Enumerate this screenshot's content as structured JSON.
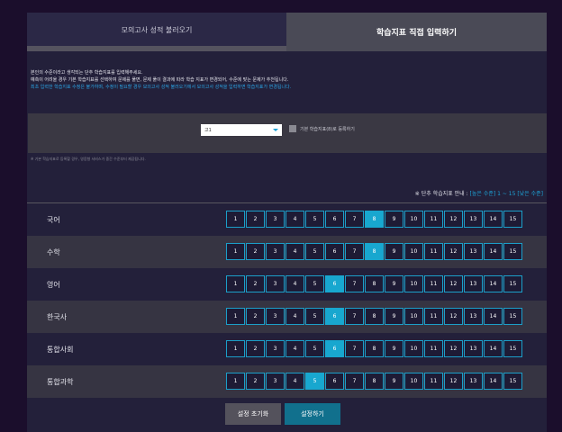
{
  "tabs": {
    "load": "모의고사 성적 불러오기",
    "direct": "학습지표 직접 입력하기"
  },
  "intro": {
    "line1": "본인의 수준이라고 생각되는 단추 학습지표를 입력해주세요.",
    "line2": "예측이 어려울 경우 기본 학습지표를 선택하여 문제를 풀면, 문제 풀이 결과에 따라 학습 지표가 변경되어, 수준에 맞는 문제가 추천됩니다.",
    "line3": "최초 입력한 학습지표 수정은 불가하며, 수정이 필요할 경우 모의고사 성적 불러오기에서 모의고사 성적을 입력하면 학습지표가 변경됩니다."
  },
  "controls": {
    "grade_value": "고1",
    "checkbox_label": "기본 학습지표(8)로 등록하기"
  },
  "footnote": "※ 기본 학습지표로 등록할 경우, 영웅형 서비스가 중간 수준부터 제공됩니다.",
  "legend": {
    "prefix": "※ 단추 학습지표 안내 : ",
    "highlight": "[높은 수준] 1 ~ 15 [낮은 수준]"
  },
  "levels": [
    "1",
    "2",
    "3",
    "4",
    "5",
    "6",
    "7",
    "8",
    "9",
    "10",
    "11",
    "12",
    "13",
    "14",
    "15"
  ],
  "subjects": [
    {
      "name": "국어",
      "selected": 8
    },
    {
      "name": "수학",
      "selected": 8
    },
    {
      "name": "영어",
      "selected": 6
    },
    {
      "name": "한국사",
      "selected": 6
    },
    {
      "name": "통합사회",
      "selected": 6
    },
    {
      "name": "통합과학",
      "selected": 5
    }
  ],
  "buttons": {
    "reset": "설정 초기화",
    "submit": "설정하기"
  },
  "colors": {
    "accent": "#18a7cf",
    "link_text": "#2aa3e3",
    "background": "#1b0e2c"
  }
}
